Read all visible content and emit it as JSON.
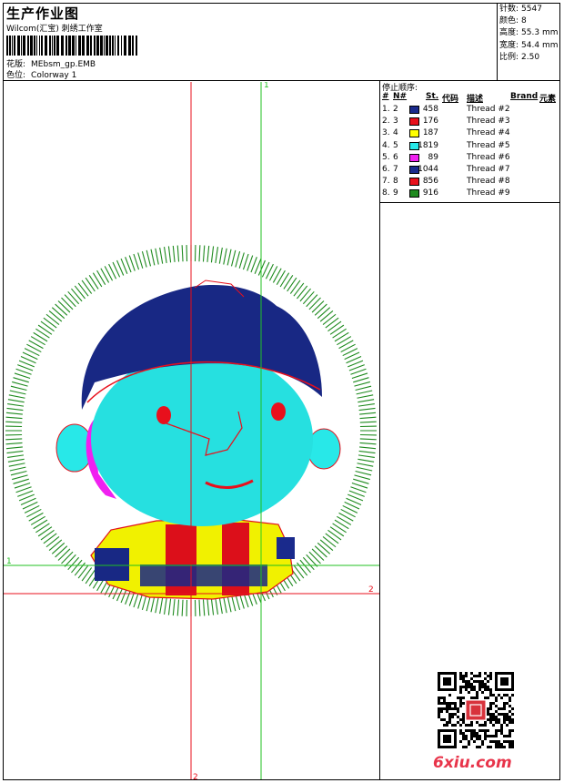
{
  "header": {
    "title": "生产作业图",
    "company": "Wilcom(汇宝) 刺绣工作室",
    "design_label": "花版:",
    "design_value": "MEbsm_gp.EMB",
    "colorway_label": "色位:",
    "colorway_value": "Colorway 1"
  },
  "stats": [
    {
      "label": "针数:",
      "value": "5547"
    },
    {
      "label": "颜色:",
      "value": "8"
    },
    {
      "label": "高度:",
      "value": "55.3 mm"
    },
    {
      "label": "宽度:",
      "value": "54.4 mm"
    },
    {
      "label": "比例:",
      "value": "2.50"
    }
  ],
  "stop_table": {
    "title": "停止顺序:",
    "headers": {
      "no": "#",
      "needle": "N#",
      "stitches": "St.",
      "code": "代码",
      "desc": "描述",
      "brand": "Brand",
      "element": "元素"
    },
    "rows": [
      {
        "no": "1.",
        "needle": "2",
        "color": "#1a2a8c",
        "stitches": "458",
        "desc": "Thread #2"
      },
      {
        "no": "2.",
        "needle": "3",
        "color": "#e8101c",
        "stitches": "176",
        "desc": "Thread #3"
      },
      {
        "no": "3.",
        "needle": "4",
        "color": "#ffff00",
        "stitches": "187",
        "desc": "Thread #4"
      },
      {
        "no": "4.",
        "needle": "5",
        "color": "#28e8e8",
        "stitches": "1819",
        "desc": "Thread #5"
      },
      {
        "no": "5.",
        "needle": "6",
        "color": "#f020f0",
        "stitches": "89",
        "desc": "Thread #6"
      },
      {
        "no": "6.",
        "needle": "7",
        "color": "#1a2a8c",
        "stitches": "1044",
        "desc": "Thread #7"
      },
      {
        "no": "7.",
        "needle": "8",
        "color": "#e8101c",
        "stitches": "856",
        "desc": "Thread #8"
      },
      {
        "no": "8.",
        "needle": "9",
        "color": "#1e8a1e",
        "stitches": "916",
        "desc": "Thread #9"
      }
    ]
  },
  "guides": {
    "v1": "1",
    "v2": "2",
    "h1": "1",
    "h2": "2"
  },
  "colors": {
    "navy": "#1a2a8c",
    "red": "#e8101c",
    "yellow": "#ffff00",
    "cyan": "#28e8e8",
    "magenta": "#f020f0",
    "green": "#1e8a1e",
    "guide_red": "#e8101c",
    "guide_green": "#20c020"
  },
  "footer": {
    "brand": "6xiu.com"
  }
}
